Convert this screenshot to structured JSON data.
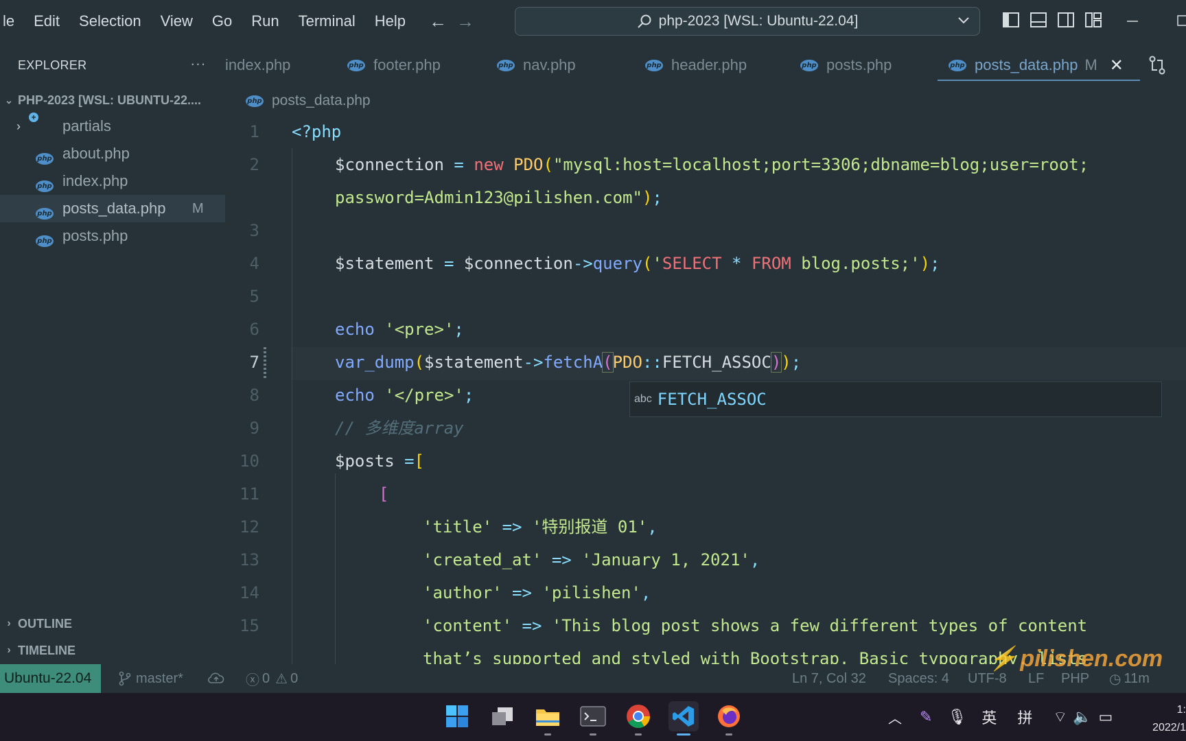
{
  "menu": [
    "le",
    "Edit",
    "Selection",
    "View",
    "Go",
    "Run",
    "Terminal",
    "Help"
  ],
  "command_center": "php-2023 [WSL: Ubuntu-22.04]",
  "sidebar": {
    "title": "EXPLORER",
    "more": "···",
    "project": "PHP-2023 [WSL: UBUNTU-22....",
    "items": [
      {
        "label": "partials",
        "type": "folder"
      },
      {
        "label": "about.php",
        "type": "php"
      },
      {
        "label": "index.php",
        "type": "php"
      },
      {
        "label": "posts_data.php",
        "type": "php",
        "badge": "M"
      },
      {
        "label": "posts.php",
        "type": "php"
      }
    ],
    "outline": "OUTLINE",
    "timeline": "TIMELINE"
  },
  "tabs": [
    {
      "label": "index.php"
    },
    {
      "label": "footer.php"
    },
    {
      "label": "nav.php"
    },
    {
      "label": "header.php"
    },
    {
      "label": "posts.php"
    },
    {
      "label": "posts_data.php",
      "modified": "M",
      "active": true
    }
  ],
  "breadcrumb": "posts_data.php",
  "editor": {
    "line_numbers": [
      "1",
      "2",
      "",
      "3",
      "4",
      "5",
      "6",
      "7",
      "8",
      "9",
      "10",
      "11",
      "12",
      "13",
      "14",
      "15"
    ],
    "current_line": "7",
    "suggestion": {
      "kind": "abc",
      "match": "FETCH_ASSOC"
    }
  },
  "statusbar": {
    "remote": "Ubuntu-22.04",
    "branch": "master*",
    "errors": "0",
    "warnings": "0",
    "position": "Ln 7, Col 32",
    "spaces": "Spaces: 4",
    "encoding": "UTF-8",
    "eol": "LF",
    "language": "PHP",
    "time": "11m"
  },
  "watermark": "pilishen.com",
  "taskbar": {
    "tray_ime_1": "英",
    "tray_ime_2": "拼",
    "clock_time": "1:",
    "clock_date": "2022/1"
  },
  "colors": {
    "background": "#263238",
    "remote_badge": "#3e8c7a",
    "accent_tab": "#5e8db5"
  }
}
